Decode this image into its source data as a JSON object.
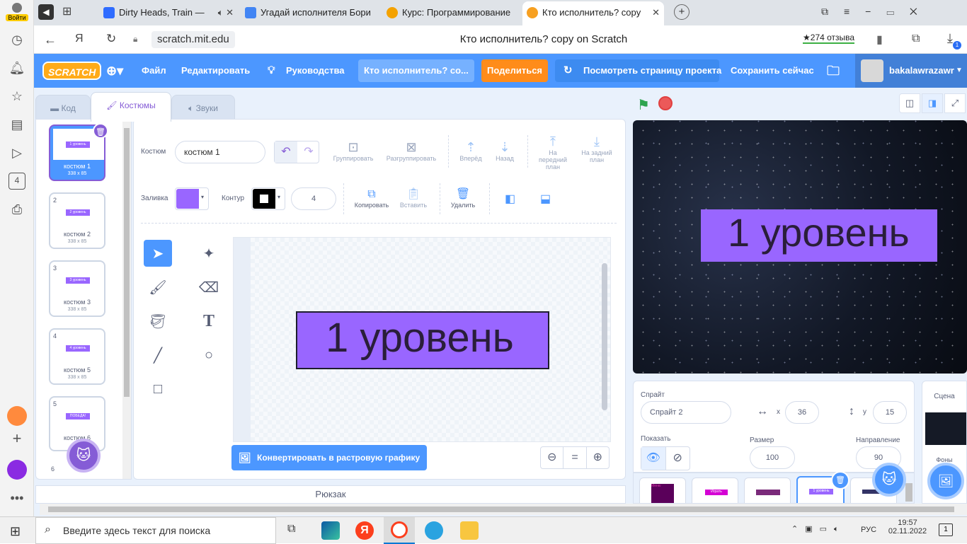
{
  "sidebar": {
    "login_label": "Войти",
    "tab_count_badge": "4"
  },
  "tabs": [
    {
      "label": "Dirty Heads, Train —",
      "icon_color": "#2f6cff"
    },
    {
      "label": "Угадай исполнителя Бори",
      "icon_color": "#4285f4"
    },
    {
      "label": "Курс: Программирование",
      "icon_color": "#f4a200"
    },
    {
      "label": "Кто исполнитель? copy",
      "icon_color": "#f7a021"
    }
  ],
  "address": {
    "domain": "scratch.mit.edu",
    "page_title": "Кто исполнитель? copy on Scratch",
    "reviews": "274 отзыва",
    "downloads_badge": "1"
  },
  "menu": {
    "logo": "SCRATCH",
    "file": "Файл",
    "edit": "Редактировать",
    "tutorials": "Руководства",
    "project_title": "Кто исполнитель? co...",
    "share": "Поделиться",
    "see_project_page": "Посмотреть страницу проекта",
    "save_now": "Сохранить сейчас",
    "username": "bakalawrazawr"
  },
  "editor_tabs": {
    "code": "Код",
    "costumes": "Костюмы",
    "sounds": "Звуки"
  },
  "costumes": [
    {
      "num": "1",
      "thumb": "1 уровень",
      "name": "костюм 1",
      "size": "338 x 85"
    },
    {
      "num": "2",
      "thumb": "2 уровень",
      "name": "костюм 2",
      "size": "338 x 85"
    },
    {
      "num": "3",
      "thumb": "3 уровень",
      "name": "костюм 3",
      "size": "338 x 85"
    },
    {
      "num": "4",
      "thumb": "4 уровень",
      "name": "костюм 5",
      "size": "338 x 85"
    },
    {
      "num": "5",
      "thumb": "ПОБЕДА!",
      "name": "костюм 6",
      "size": ""
    },
    {
      "num": "6",
      "thumb": "",
      "name": "",
      "size": ""
    }
  ],
  "paint": {
    "costume_label": "Костюм",
    "costume_name": "костюм 1",
    "group": "Группировать",
    "ungroup": "Разгруппировать",
    "forward": "Вперёд",
    "backward": "Назад",
    "front": "На передний план",
    "back": "На задний план",
    "fill_label": "Заливка",
    "fill_color": "#9966ff",
    "outline_label": "Контур",
    "outline_width": "4",
    "copy": "Копировать",
    "paste": "Вставить",
    "delete": "Удалить",
    "canvas_text": "1 уровень",
    "convert_bitmap": "Конвертировать в растровую графику"
  },
  "stage": {
    "text": "1 уровень"
  },
  "sprite_info": {
    "sprite_label": "Спрайт",
    "sprite_name": "Спрайт 2",
    "x_label": "x",
    "x": "36",
    "y_label": "y",
    "y": "15",
    "show_label": "Показать",
    "size_label": "Размер",
    "size": "100",
    "direction_label": "Направление",
    "direction": "90"
  },
  "stage_panel": {
    "label": "Сцена",
    "backdrops_label": "Фоны"
  },
  "sprites": [
    {
      "thumb": "Меню",
      "color": "#5a005a"
    },
    {
      "thumb": "Играть",
      "color": "#d400d4"
    },
    {
      "thumb": "",
      "color": "#7a2a7a"
    },
    {
      "thumb": "1 уровень",
      "color": "#9966ff"
    },
    {
      "thumb": "",
      "color": "#333366"
    }
  ],
  "backpack": "Рюкзак",
  "taskbar": {
    "search_placeholder": "Введите здесь текст для поиска",
    "lang": "РУС",
    "time": "19:57",
    "date": "02.11.2022",
    "notif_count": "1"
  }
}
